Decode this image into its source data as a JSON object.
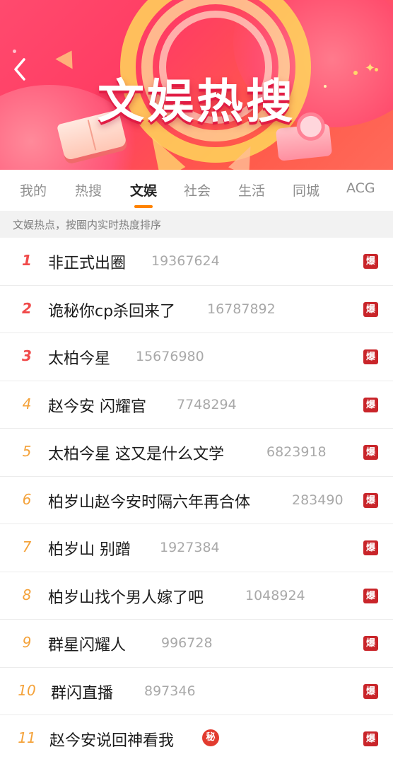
{
  "header": {
    "title": "文娱热搜"
  },
  "tabs": [
    {
      "label": "我的"
    },
    {
      "label": "热搜"
    },
    {
      "label": "文娱"
    },
    {
      "label": "社会"
    },
    {
      "label": "生活"
    },
    {
      "label": "同城"
    },
    {
      "label": "ACG"
    }
  ],
  "active_tab": "文娱",
  "info": {
    "text": "文娱热点，按圈内实时热度排序"
  },
  "list": [
    {
      "rank": "1",
      "title": "非正式出圈",
      "count": "19367624",
      "badge": "爆"
    },
    {
      "rank": "2",
      "title": "诡秘你cp杀回来了",
      "count": "16787892",
      "badge": "爆"
    },
    {
      "rank": "3",
      "title": "太柏今星",
      "count": "15676980",
      "badge": "爆"
    },
    {
      "rank": "4",
      "title": "赵今安 闪耀官",
      "count": "7748294",
      "badge": "爆"
    },
    {
      "rank": "5",
      "title": "太柏今星 这又是什么文学",
      "count": "6823918",
      "badge": "爆"
    },
    {
      "rank": "6",
      "title": "柏岁山赵今安时隔六年再合体",
      "count": "283490",
      "badge": "爆"
    },
    {
      "rank": "7",
      "title": "柏岁山 别蹭",
      "count": "1927384",
      "badge": "爆"
    },
    {
      "rank": "8",
      "title": "柏岁山找个男人嫁了吧",
      "count": "1048924",
      "badge": "爆"
    },
    {
      "rank": "9",
      "title": "群星闪耀人",
      "count": "996728",
      "badge": "爆"
    },
    {
      "rank": "10",
      "title": "群闪直播",
      "count": "897346",
      "badge": "爆"
    },
    {
      "rank": "11",
      "title": "赵今安说回神看我",
      "tag": "秘",
      "badge": "爆"
    }
  ],
  "colors": {
    "accent": "#ff8200",
    "badge": "#c9252a",
    "rank_top": "#f04a4a",
    "rank_other": "#f4a23a",
    "banner": "#ff3d63"
  },
  "icons": {
    "back": "chevron-left-icon"
  }
}
